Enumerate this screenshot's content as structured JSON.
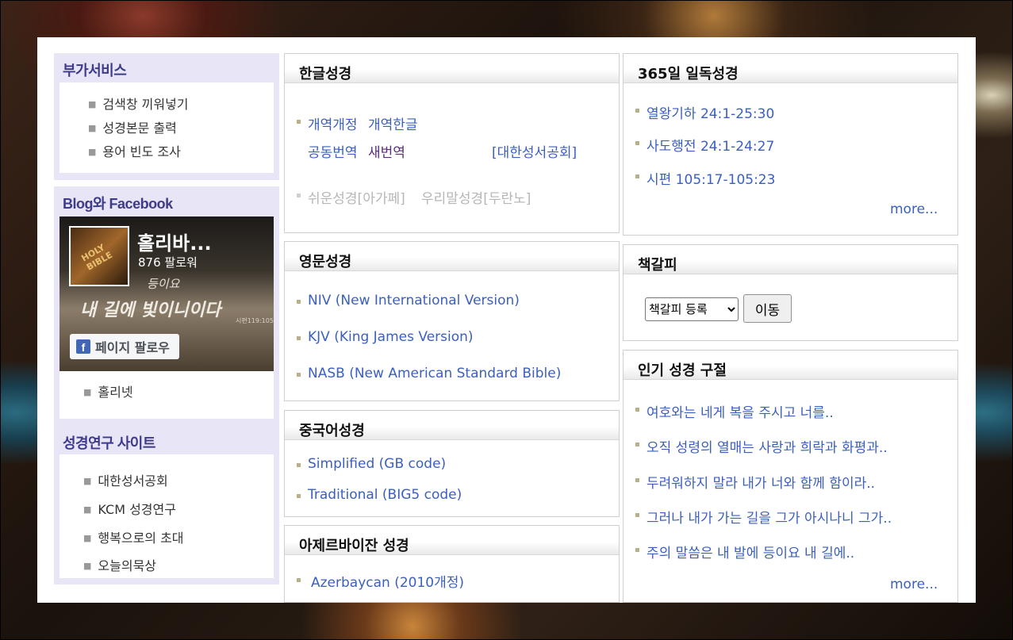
{
  "left": {
    "services": {
      "title": "부가서비스",
      "items": [
        "검색창 끼워넣기",
        "성경본문 출력",
        "용어 빈도 조사"
      ]
    },
    "blog": {
      "title": "Blog와 Facebook",
      "fb_name": "홀리바...",
      "fb_followers": "876 팔로워",
      "fb_thumb_text": "HOLY BIBLE",
      "fb_script_line1": "등이요",
      "fb_script_line2": "내 길에 빛이니이다",
      "fb_script_line3": "시편119:105",
      "fb_follow_button": "페이지 팔로우",
      "fb_logo_letter": "f",
      "items": [
        "홀리넷"
      ]
    },
    "research": {
      "title": "성경연구 사이트",
      "items": [
        "대한성서공회",
        "KCM 성경연구",
        "행복으로의 초대",
        "오늘의묵상"
      ]
    }
  },
  "korean_bible": {
    "title": "한글성경",
    "row1": [
      "개역개정",
      "개역한글"
    ],
    "row2": [
      "공동번역",
      "새번역"
    ],
    "publisher": "[대한성서공회]",
    "row3": [
      "쉬운성경[아가페]",
      "우리말성경[두란노]"
    ]
  },
  "english_bible": {
    "title": "영문성경",
    "items": [
      "NIV (New International Version)",
      "KJV (King James Version)",
      "NASB (New American Standard Bible)"
    ]
  },
  "chinese_bible": {
    "title": "중국어성경",
    "items": [
      "Simplified (GB code)",
      "Traditional (BIG5 code)"
    ]
  },
  "azerbaijani_bible": {
    "title": "아제르바이잔 성경",
    "items": [
      "Azerbaycan (2010개정)"
    ]
  },
  "daily_reading": {
    "title": "365일 일독성경",
    "items": [
      "열왕기하 24:1-25:30",
      "사도행전 24:1-24:27",
      "시편 105:17-105:23"
    ],
    "more": "more..."
  },
  "bookmark": {
    "title": "책갈피",
    "select_value": "책갈피 등록",
    "go_button": "이동"
  },
  "popular_verses": {
    "title": "인기 성경 구절",
    "items": [
      "여호와는 네게 복을 주시고 너를..",
      "오직 성령의 열매는 사랑과 희락과 화평과..",
      "두려워하지 말라 내가 너와 함께 함이라..",
      "그러나 내가 가는 길을 그가 아시나니 그가..",
      "주의 말씀은 내 발에 등이요 내 길에.."
    ],
    "more": "more..."
  },
  "colors": {
    "link": "#3a5fbf",
    "sidebar_bg": "#e7e5f6",
    "sidebar_title": "#3e3b8a",
    "facebook_blue": "#4267b2"
  }
}
